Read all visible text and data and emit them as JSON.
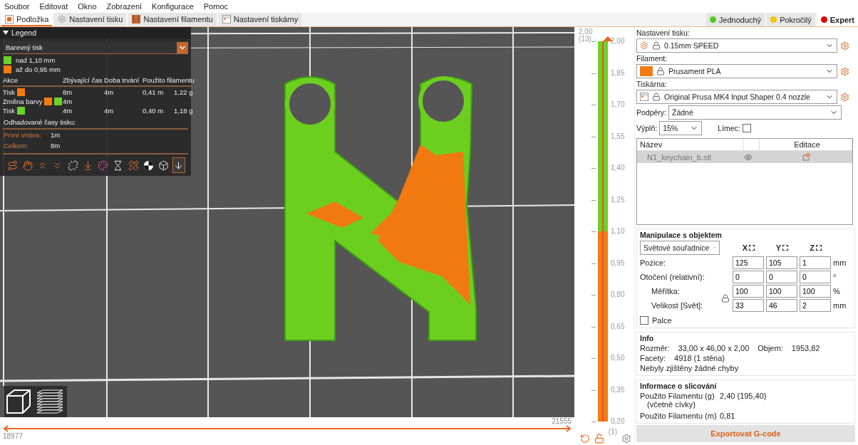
{
  "menu": [
    "Soubor",
    "Editovat",
    "Okno",
    "Zobrazení",
    "Konfigurace",
    "Pomoc"
  ],
  "tabs": [
    {
      "label": "Podložka",
      "kind": "plate",
      "selected": true
    },
    {
      "label": "Nastavení tisku",
      "kind": "print",
      "selected": false
    },
    {
      "label": "Nastavení filamentu",
      "kind": "filament",
      "selected": false
    },
    {
      "label": "Nastavení tiskárny",
      "kind": "printer",
      "selected": false
    }
  ],
  "modes": [
    {
      "label": "Jednoduchý",
      "color": "#55c81e",
      "selected": false
    },
    {
      "label": "Pokročilý",
      "color": "#f0c800",
      "selected": false
    },
    {
      "label": "Expert",
      "color": "#e00000",
      "selected": true
    }
  ],
  "legend": {
    "title": "Legend",
    "expanded": true,
    "view_type": "Barevný tisk",
    "ranges": [
      {
        "label": "nad 1,10 mm",
        "color": "#6cd12a"
      },
      {
        "label": "až do 0,95 mm",
        "color": "#f47b12"
      }
    ],
    "columns": [
      "Akce",
      "Zbývající čas",
      "Doba trvání",
      "Použito filamentu"
    ],
    "rows": [
      {
        "action": "Tisk",
        "swatches": [
          {
            "color": "#f47b12"
          }
        ],
        "remaining": "8m",
        "duration": "4m",
        "length": "0,41 m",
        "weight": "1,22 g"
      },
      {
        "action": "Změna barvy",
        "swatches": [
          {
            "color": "#f47b12"
          },
          {
            "color": "#6cd12a"
          }
        ],
        "remaining": "4m"
      },
      {
        "action": "Tisk",
        "swatches": [
          {
            "color": "#6cd12a"
          }
        ],
        "remaining": "4m",
        "duration": "4m",
        "length": "0,40 m",
        "weight": "1,18 g"
      }
    ],
    "estimates_title": "Odhadované časy tisku:",
    "estimates": [
      {
        "label": "První vrstva:",
        "value": "1m"
      },
      {
        "label": "Celkem:",
        "value": "8m"
      }
    ],
    "toolbar": [
      {
        "kind": "travel",
        "selected": false
      },
      {
        "kind": "wipe",
        "selected": false
      },
      {
        "kind": "retract",
        "selected": false
      },
      {
        "kind": "deretract",
        "selected": false
      },
      {
        "kind": "seam",
        "selected": false
      },
      {
        "kind": "toolchange",
        "selected": false
      },
      {
        "kind": "colorchange",
        "selected": false
      },
      {
        "kind": "pause",
        "selected": false
      },
      {
        "kind": "custom",
        "selected": false
      },
      {
        "kind": "cog",
        "selected": false
      },
      {
        "kind": "shells",
        "selected": false
      },
      {
        "kind": "tool",
        "selected": true
      }
    ]
  },
  "vertical_slider": {
    "top_value": "2,00",
    "top_layer": "(13)",
    "bottom_layer": "(1)",
    "bands": [
      {
        "color": "#6cd12a",
        "ticks": [
          "2,00",
          "1,85",
          "1,70",
          "1,55",
          "1,40",
          "1,25"
        ]
      },
      {
        "color": "#f47b12",
        "ticks": [
          "1,10",
          "0,95",
          "0,80",
          "0,65",
          "0,50",
          "0,35",
          "0,20"
        ]
      }
    ]
  },
  "horizontal_slider": {
    "start": "18977",
    "end": "21555",
    "level": 1
  },
  "sidebar": {
    "print_label": "Nastavení tisku:",
    "print_value": "0.15mm SPEED",
    "filament_label": "Filament:",
    "filaments": [
      {
        "name": "Prusament PLA",
        "color": "#f47b12"
      }
    ],
    "printer_label": "Tiskárna:",
    "printer_value": "Original Prusa MK4 Input Shaper 0.4 nozzle",
    "supports_label": "Podpěry:",
    "supports_value": "Žádné",
    "infill_label": "Výplň:",
    "infill_value": "15%",
    "brim_label": "Límec:",
    "brim_checked": false,
    "objects": {
      "columns": [
        "Název",
        "Editace"
      ],
      "rows": [
        {
          "name": "N1_keychain_b.stl",
          "selected": true
        }
      ]
    },
    "manipulation": {
      "title": "Manipulace s objektem",
      "coords": "Světové souřadnice",
      "axes": [
        "X",
        "Y",
        "Z"
      ],
      "rows": [
        {
          "label": "Pozice:",
          "values": [
            "125",
            "105",
            "1"
          ],
          "unit": "mm"
        },
        {
          "label": "Otočení (relativní):",
          "values": [
            "0",
            "0",
            "0"
          ],
          "unit": "°"
        },
        {
          "label": "Měřítka:",
          "values": [
            "100",
            "100",
            "100"
          ],
          "unit": "%"
        },
        {
          "label": "Velikost [Svět]:",
          "values": [
            "33",
            "46",
            "2"
          ],
          "unit": "mm"
        }
      ],
      "inches_label": "Palce",
      "inches_checked": false
    },
    "info": {
      "title": "Info",
      "size_label": "Rozměr:",
      "size": "33,00 x 46,00 x 2,00",
      "volume_label": "Objem:",
      "volume": "1953,82",
      "facets_label": "Facety:",
      "facets": "4918 (1 stěna)",
      "errors": "Nebyly zjištěny žádné chyby"
    },
    "slicing": {
      "title": "Informace o slicování",
      "rows": [
        {
          "label": "Použito Filamentu (g)",
          "sub": "(včetně cívky)",
          "value": "2,40 (195,40)"
        },
        {
          "label": "Použito Filamentu (m)",
          "value": "0,81"
        }
      ]
    },
    "export": "Exportovat G-code"
  }
}
